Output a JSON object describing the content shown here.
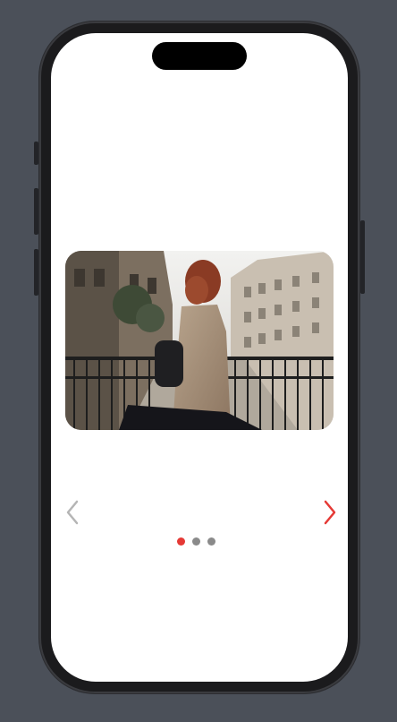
{
  "carousel": {
    "slide_image": "woman-in-trench-coat-on-city-stairs-photo",
    "prev_icon": "chevron-left-icon",
    "next_icon": "chevron-right-icon",
    "slide_count": 3,
    "active_index": 0,
    "colors": {
      "active_dot": "#e53935",
      "inactive_dot": "#8a8a8a",
      "next_arrow": "#e53935",
      "prev_arrow": "#b5b5b5"
    }
  }
}
